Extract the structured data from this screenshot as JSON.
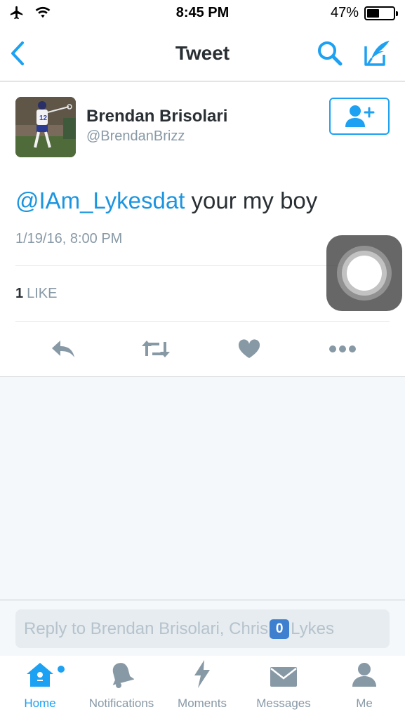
{
  "status_bar": {
    "time": "8:45 PM",
    "battery": "47%",
    "battery_level": 0.47
  },
  "nav": {
    "title": "Tweet"
  },
  "tweet": {
    "author_name": "Brendan Brisolari",
    "author_handle": "@BrendanBrizz",
    "mention": "@IAm_Lykesdat",
    "text": " your my boy",
    "timestamp": "1/19/16, 8:00 PM",
    "like_count": "1",
    "like_label": "LIKE"
  },
  "reply": {
    "placeholder_pre": "Reply to Brendan Brisolari, Chris",
    "placeholder_emoji": "0",
    "placeholder_post": "Lykes"
  },
  "tabs": [
    {
      "label": "Home"
    },
    {
      "label": "Notifications"
    },
    {
      "label": "Moments"
    },
    {
      "label": "Messages"
    },
    {
      "label": "Me"
    }
  ],
  "colors": {
    "accent": "#1da1f2",
    "mention": "#1b95e0",
    "muted": "#8899a6",
    "text": "#292f33"
  }
}
